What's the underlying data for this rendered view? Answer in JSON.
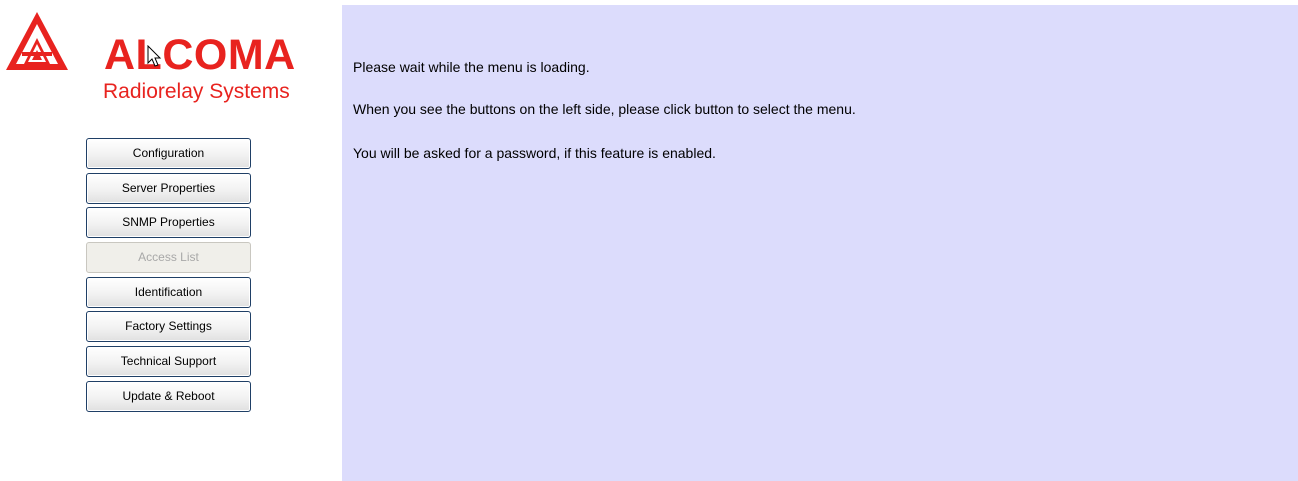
{
  "brand": {
    "name": "ALCOMA",
    "tagline": "Radiorelay Systems",
    "color": "#e8231f"
  },
  "menu": {
    "items": [
      {
        "label": "Configuration",
        "enabled": true
      },
      {
        "label": "Server Properties",
        "enabled": true
      },
      {
        "label": "SNMP Properties",
        "enabled": true
      },
      {
        "label": "Access List",
        "enabled": false
      },
      {
        "label": "Identification",
        "enabled": true
      },
      {
        "label": "Factory Settings",
        "enabled": true
      },
      {
        "label": "Technical Support",
        "enabled": true
      },
      {
        "label": "Update & Reboot",
        "enabled": true
      }
    ]
  },
  "content": {
    "background": "#dcdcfc",
    "messages": [
      "Please wait while the menu is loading.",
      "When you see the buttons on the left side, please click button to select the menu.",
      "You will be asked for a password, if this feature is enabled."
    ]
  },
  "icons": {
    "logo": "alcoma-triangle-logo-icon",
    "cursor": "mouse-pointer-icon"
  }
}
